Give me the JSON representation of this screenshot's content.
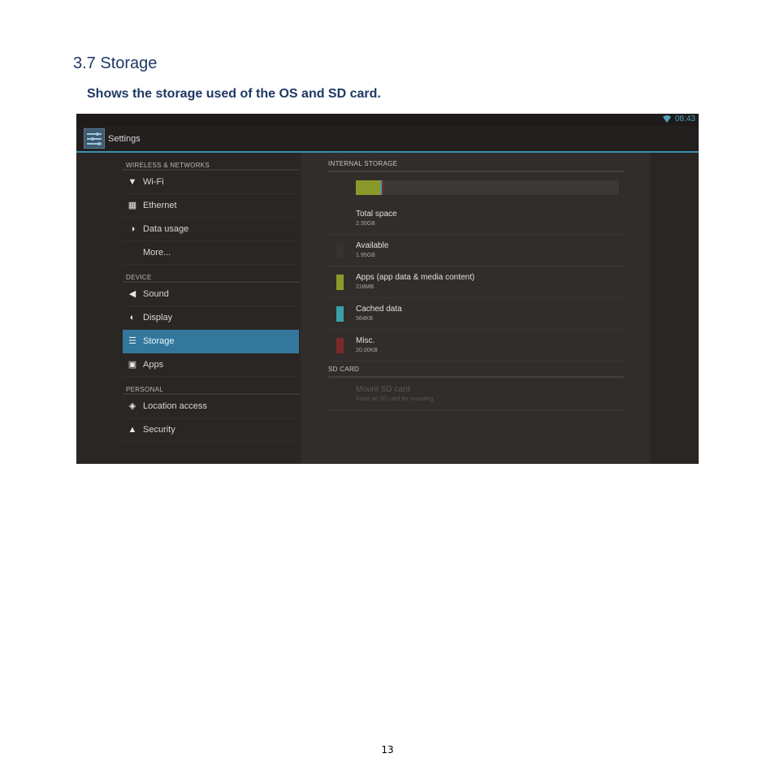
{
  "document": {
    "heading": "3.7 Storage",
    "subtitle": "Shows the storage used of the OS and SD card.",
    "page_number": "13"
  },
  "statusbar": {
    "time": "08:43",
    "wifi_icon": "wifi-icon"
  },
  "actionbar": {
    "title": "Settings",
    "app_icon": "settings-icon"
  },
  "sidebar": {
    "sections": [
      {
        "header": "WIRELESS & NETWORKS",
        "items": [
          {
            "label": "Wi-Fi",
            "icon": "wifi-icon",
            "glyph": "▼"
          },
          {
            "label": "Ethernet",
            "icon": "ethernet-icon",
            "glyph": "▦"
          },
          {
            "label": "Data usage",
            "icon": "data-usage-icon",
            "glyph": "◑"
          },
          {
            "label": "More...",
            "icon": "",
            "glyph": ""
          }
        ]
      },
      {
        "header": "DEVICE",
        "items": [
          {
            "label": "Sound",
            "icon": "sound-icon",
            "glyph": "◀"
          },
          {
            "label": "Display",
            "icon": "display-icon",
            "glyph": "◐"
          },
          {
            "label": "Storage",
            "icon": "storage-icon",
            "glyph": "☰",
            "active": true
          },
          {
            "label": "Apps",
            "icon": "apps-icon",
            "glyph": "▣"
          }
        ]
      },
      {
        "header": "PERSONAL",
        "items": [
          {
            "label": "Location access",
            "icon": "location-icon",
            "glyph": "◈"
          },
          {
            "label": "Security",
            "icon": "lock-icon",
            "glyph": "▲"
          }
        ]
      }
    ]
  },
  "storage": {
    "internal_header": "INTERNAL STORAGE",
    "usage_bar": {
      "total_gb": 2.3,
      "segments": [
        {
          "name": "apps",
          "fraction": 0.092,
          "color": "#8a9a2a"
        },
        {
          "name": "cached",
          "fraction": 0.008,
          "color": "#3a9fa6"
        },
        {
          "name": "misc",
          "fraction": 0.006,
          "color": "#7a2a28"
        }
      ]
    },
    "rows": [
      {
        "title": "Total space",
        "summary": "2.30GB",
        "swatch": null
      },
      {
        "title": "Available",
        "summary": "1.95GB",
        "swatch": "#363232"
      },
      {
        "title": "Apps (app data & media content)",
        "summary": "218MB",
        "swatch": "#8a9a2a"
      },
      {
        "title": "Cached data",
        "summary": "564KB",
        "swatch": "#3a9fa6"
      },
      {
        "title": "Misc.",
        "summary": "20.00KB",
        "swatch": "#7a2a28"
      }
    ],
    "sd_header": "SD CARD",
    "sd_row": {
      "title": "Mount SD card",
      "summary": "Insert an SD card for mounting",
      "enabled": false
    }
  },
  "colors": {
    "accent": "#33789c",
    "heading_text": "#1f3864"
  }
}
